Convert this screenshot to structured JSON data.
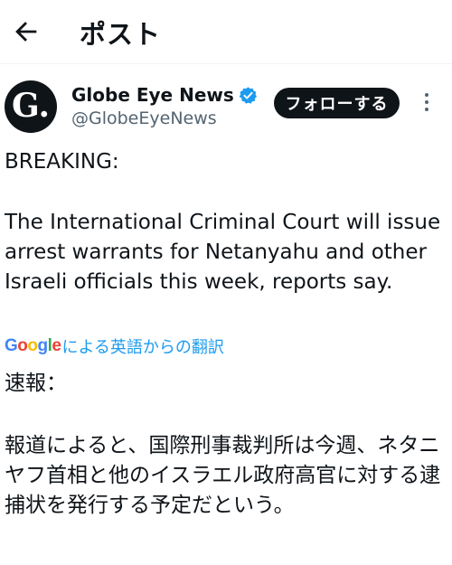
{
  "header": {
    "title": "ポスト"
  },
  "account": {
    "name": "Globe Eye News",
    "handle": "@GlobeEyeNews",
    "avatar_letter": "G.",
    "verified_color": "#1d9bf0"
  },
  "actions": {
    "follow_label": "フォローする"
  },
  "post": {
    "heading": "BREAKING:",
    "body": "The International Criminal Court will issue arrest warrants for Netanyahu and other Israeli officials this week, reports say."
  },
  "translation": {
    "provider_logo": [
      "G",
      "o",
      "o",
      "g",
      "l",
      "e"
    ],
    "label": "による英語からの翻訳",
    "heading": "速報：",
    "body": "報道によると、国際刑事裁判所は今週、ネタニヤフ首相と他のイスラエル政府高官に対する逮捕状を発行する予定だという。"
  },
  "icons": {
    "back": "back-arrow-icon",
    "verified": "verified-badge-icon",
    "more": "more-dots-icon"
  }
}
